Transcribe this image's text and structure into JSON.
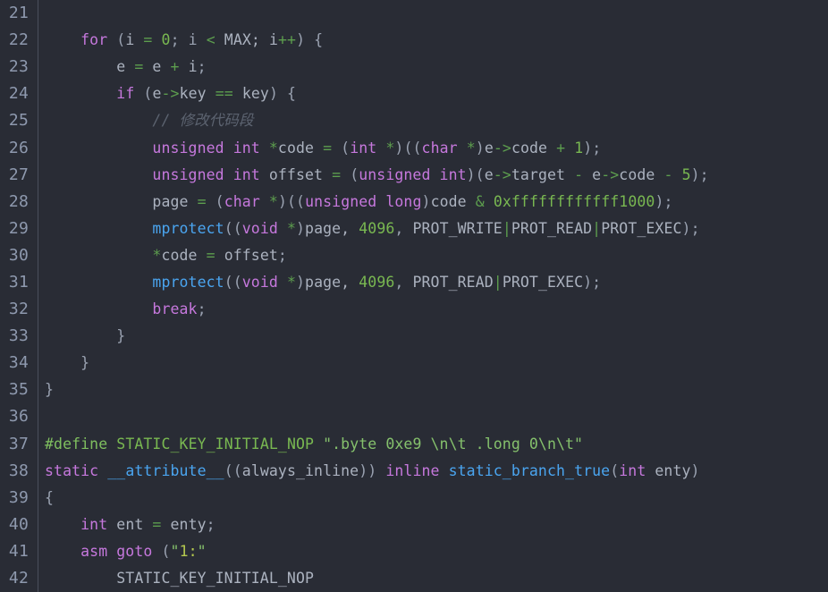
{
  "editor": {
    "name": "code-editor",
    "theme": "one-dark",
    "colors": {
      "background": "#292c35",
      "gutter_text": "#8e99ae",
      "gutter_rule": "#4a4f5c",
      "default_text": "#abb2bf",
      "keyword": "#c678dd",
      "operator": "#5d9e4e",
      "number": "#79b851",
      "function": "#4aa5f0",
      "comment": "#5c6370",
      "preprocessor": "#7fbf5f",
      "string": "#85c16c"
    },
    "language": "c",
    "first_line_number": 21,
    "last_line_number": 42
  },
  "lines": [
    {
      "number": "21",
      "text": ""
    },
    {
      "number": "22",
      "text": "    for (i = 0; i < MAX; i++) {"
    },
    {
      "number": "23",
      "text": "        e = e + i;"
    },
    {
      "number": "24",
      "text": "        if (e->key == key) {"
    },
    {
      "number": "25",
      "text": "            // 修改代码段"
    },
    {
      "number": "26",
      "text": "            unsigned int *code = (int *)((char *)e->code + 1);"
    },
    {
      "number": "27",
      "text": "            unsigned int offset = (unsigned int)(e->target - e->code - 5);"
    },
    {
      "number": "28",
      "text": "            page = (char *)((unsigned long)code & 0xffffffffffff1000);"
    },
    {
      "number": "29",
      "text": "            mprotect((void *)page, 4096, PROT_WRITE|PROT_READ|PROT_EXEC);"
    },
    {
      "number": "30",
      "text": "            *code = offset;"
    },
    {
      "number": "31",
      "text": "            mprotect((void *)page, 4096, PROT_READ|PROT_EXEC);"
    },
    {
      "number": "32",
      "text": "            break;"
    },
    {
      "number": "33",
      "text": "        }"
    },
    {
      "number": "34",
      "text": "    }"
    },
    {
      "number": "35",
      "text": "}"
    },
    {
      "number": "36",
      "text": ""
    },
    {
      "number": "37",
      "text": "#define STATIC_KEY_INITIAL_NOP \".byte 0xe9 \\n\\t .long 0\\n\\t\""
    },
    {
      "number": "38",
      "text": "static __attribute__((always_inline)) inline static_branch_true(int enty)"
    },
    {
      "number": "39",
      "text": "{"
    },
    {
      "number": "40",
      "text": "    int ent = enty;"
    },
    {
      "number": "41",
      "text": "    asm goto (\"1:\""
    },
    {
      "number": "42",
      "text": "        STATIC_KEY_INITIAL_NOP"
    }
  ],
  "tokens": {
    "line21": [],
    "line22": [
      {
        "t": "    ",
        "c": "t-id"
      },
      {
        "t": "for",
        "c": "t-kw"
      },
      {
        "t": " ",
        "c": "t-id"
      },
      {
        "t": "(",
        "c": "t-punc"
      },
      {
        "t": "i ",
        "c": "t-id"
      },
      {
        "t": "=",
        "c": "t-op"
      },
      {
        "t": " ",
        "c": "t-id"
      },
      {
        "t": "0",
        "c": "t-num"
      },
      {
        "t": "; i ",
        "c": "t-punc"
      },
      {
        "t": "<",
        "c": "t-op"
      },
      {
        "t": " MAX; i",
        "c": "t-id"
      },
      {
        "t": "++",
        "c": "t-op"
      },
      {
        "t": ") {",
        "c": "t-punc"
      }
    ],
    "line23": [
      {
        "t": "        e ",
        "c": "t-id"
      },
      {
        "t": "=",
        "c": "t-op"
      },
      {
        "t": " e ",
        "c": "t-id"
      },
      {
        "t": "+",
        "c": "t-op"
      },
      {
        "t": " i",
        "c": "t-id"
      },
      {
        "t": ";",
        "c": "t-punc"
      }
    ],
    "line24": [
      {
        "t": "        ",
        "c": "t-id"
      },
      {
        "t": "if",
        "c": "t-kw"
      },
      {
        "t": " ",
        "c": "t-id"
      },
      {
        "t": "(",
        "c": "t-punc"
      },
      {
        "t": "e",
        "c": "t-id"
      },
      {
        "t": "->",
        "c": "t-op"
      },
      {
        "t": "key ",
        "c": "t-id"
      },
      {
        "t": "==",
        "c": "t-op"
      },
      {
        "t": " key",
        "c": "t-id"
      },
      {
        "t": ") {",
        "c": "t-punc"
      }
    ],
    "line25": [
      {
        "t": "            ",
        "c": "t-id"
      },
      {
        "t": "// 修改代码段",
        "c": "t-comment"
      }
    ],
    "line26": [
      {
        "t": "            ",
        "c": "t-id"
      },
      {
        "t": "unsigned int",
        "c": "t-kw"
      },
      {
        "t": " ",
        "c": "t-id"
      },
      {
        "t": "*",
        "c": "t-op"
      },
      {
        "t": "code ",
        "c": "t-id"
      },
      {
        "t": "=",
        "c": "t-op"
      },
      {
        "t": " ",
        "c": "t-id"
      },
      {
        "t": "(",
        "c": "t-punc"
      },
      {
        "t": "int",
        "c": "t-kw"
      },
      {
        "t": " ",
        "c": "t-id"
      },
      {
        "t": "*",
        "c": "t-op"
      },
      {
        "t": ")((",
        "c": "t-punc"
      },
      {
        "t": "char",
        "c": "t-kw"
      },
      {
        "t": " ",
        "c": "t-id"
      },
      {
        "t": "*",
        "c": "t-op"
      },
      {
        "t": ")",
        "c": "t-punc"
      },
      {
        "t": "e",
        "c": "t-id"
      },
      {
        "t": "->",
        "c": "t-op"
      },
      {
        "t": "code ",
        "c": "t-id"
      },
      {
        "t": "+",
        "c": "t-op"
      },
      {
        "t": " ",
        "c": "t-id"
      },
      {
        "t": "1",
        "c": "t-num"
      },
      {
        "t": ");",
        "c": "t-punc"
      }
    ],
    "line27": [
      {
        "t": "            ",
        "c": "t-id"
      },
      {
        "t": "unsigned int",
        "c": "t-kw"
      },
      {
        "t": " offset ",
        "c": "t-id"
      },
      {
        "t": "=",
        "c": "t-op"
      },
      {
        "t": " ",
        "c": "t-id"
      },
      {
        "t": "(",
        "c": "t-punc"
      },
      {
        "t": "unsigned int",
        "c": "t-kw"
      },
      {
        "t": ")(",
        "c": "t-punc"
      },
      {
        "t": "e",
        "c": "t-id"
      },
      {
        "t": "->",
        "c": "t-op"
      },
      {
        "t": "target ",
        "c": "t-id"
      },
      {
        "t": "-",
        "c": "t-op"
      },
      {
        "t": " e",
        "c": "t-id"
      },
      {
        "t": "->",
        "c": "t-op"
      },
      {
        "t": "code ",
        "c": "t-id"
      },
      {
        "t": "-",
        "c": "t-op"
      },
      {
        "t": " ",
        "c": "t-id"
      },
      {
        "t": "5",
        "c": "t-num"
      },
      {
        "t": ");",
        "c": "t-punc"
      }
    ],
    "line28": [
      {
        "t": "            page ",
        "c": "t-id"
      },
      {
        "t": "=",
        "c": "t-op"
      },
      {
        "t": " ",
        "c": "t-id"
      },
      {
        "t": "(",
        "c": "t-punc"
      },
      {
        "t": "char",
        "c": "t-kw"
      },
      {
        "t": " ",
        "c": "t-id"
      },
      {
        "t": "*",
        "c": "t-op"
      },
      {
        "t": ")((",
        "c": "t-punc"
      },
      {
        "t": "unsigned long",
        "c": "t-kw"
      },
      {
        "t": ")",
        "c": "t-punc"
      },
      {
        "t": "code ",
        "c": "t-id"
      },
      {
        "t": "&",
        "c": "t-op"
      },
      {
        "t": " ",
        "c": "t-id"
      },
      {
        "t": "0xffffffffffff1000",
        "c": "t-num"
      },
      {
        "t": ");",
        "c": "t-punc"
      }
    ],
    "line29": [
      {
        "t": "            ",
        "c": "t-id"
      },
      {
        "t": "mprotect",
        "c": "t-fn"
      },
      {
        "t": "((",
        "c": "t-punc"
      },
      {
        "t": "void",
        "c": "t-kw"
      },
      {
        "t": " ",
        "c": "t-id"
      },
      {
        "t": "*",
        "c": "t-op"
      },
      {
        "t": ")",
        "c": "t-punc"
      },
      {
        "t": "page, ",
        "c": "t-id"
      },
      {
        "t": "4096",
        "c": "t-num"
      },
      {
        "t": ", ",
        "c": "t-punc"
      },
      {
        "t": "PROT_WRITE",
        "c": "t-id"
      },
      {
        "t": "|",
        "c": "t-op"
      },
      {
        "t": "PROT_READ",
        "c": "t-id"
      },
      {
        "t": "|",
        "c": "t-op"
      },
      {
        "t": "PROT_EXEC",
        "c": "t-id"
      },
      {
        "t": ");",
        "c": "t-punc"
      }
    ],
    "line30": [
      {
        "t": "            ",
        "c": "t-id"
      },
      {
        "t": "*",
        "c": "t-op"
      },
      {
        "t": "code ",
        "c": "t-id"
      },
      {
        "t": "=",
        "c": "t-op"
      },
      {
        "t": " offset",
        "c": "t-id"
      },
      {
        "t": ";",
        "c": "t-punc"
      }
    ],
    "line31": [
      {
        "t": "            ",
        "c": "t-id"
      },
      {
        "t": "mprotect",
        "c": "t-fn"
      },
      {
        "t": "((",
        "c": "t-punc"
      },
      {
        "t": "void",
        "c": "t-kw"
      },
      {
        "t": " ",
        "c": "t-id"
      },
      {
        "t": "*",
        "c": "t-op"
      },
      {
        "t": ")",
        "c": "t-punc"
      },
      {
        "t": "page, ",
        "c": "t-id"
      },
      {
        "t": "4096",
        "c": "t-num"
      },
      {
        "t": ", ",
        "c": "t-punc"
      },
      {
        "t": "PROT_READ",
        "c": "t-id"
      },
      {
        "t": "|",
        "c": "t-op"
      },
      {
        "t": "PROT_EXEC",
        "c": "t-id"
      },
      {
        "t": ");",
        "c": "t-punc"
      }
    ],
    "line32": [
      {
        "t": "            ",
        "c": "t-id"
      },
      {
        "t": "break",
        "c": "t-kw"
      },
      {
        "t": ";",
        "c": "t-punc"
      }
    ],
    "line33": [
      {
        "t": "        }",
        "c": "t-punc"
      }
    ],
    "line34": [
      {
        "t": "    }",
        "c": "t-punc"
      }
    ],
    "line35": [
      {
        "t": "}",
        "c": "t-punc"
      }
    ],
    "line36": [],
    "line37": [
      {
        "t": "#define",
        "c": "t-pre"
      },
      {
        "t": " ",
        "c": "t-id"
      },
      {
        "t": "STATIC_KEY_INITIAL_NOP",
        "c": "t-macro"
      },
      {
        "t": " ",
        "c": "t-id"
      },
      {
        "t": "\".byte ",
        "c": "t-str"
      },
      {
        "t": "0xe9",
        "c": "t-str"
      },
      {
        "t": " \\n\\t .long 0\\n\\t\"",
        "c": "t-str"
      }
    ],
    "line38": [
      {
        "t": "static",
        "c": "t-kw"
      },
      {
        "t": " ",
        "c": "t-id"
      },
      {
        "t": "__attribute__",
        "c": "t-fn"
      },
      {
        "t": "((",
        "c": "t-punc"
      },
      {
        "t": "always_inline",
        "c": "t-id"
      },
      {
        "t": ")) ",
        "c": "t-punc"
      },
      {
        "t": "inline",
        "c": "t-kw"
      },
      {
        "t": " ",
        "c": "t-id"
      },
      {
        "t": "static_branch_true",
        "c": "t-fn"
      },
      {
        "t": "(",
        "c": "t-punc"
      },
      {
        "t": "int",
        "c": "t-kw"
      },
      {
        "t": " enty",
        "c": "t-id"
      },
      {
        "t": ")",
        "c": "t-punc"
      }
    ],
    "line39": [
      {
        "t": "{",
        "c": "t-punc"
      }
    ],
    "line40": [
      {
        "t": "    ",
        "c": "t-id"
      },
      {
        "t": "int",
        "c": "t-kw"
      },
      {
        "t": " ent ",
        "c": "t-id"
      },
      {
        "t": "=",
        "c": "t-op"
      },
      {
        "t": " enty",
        "c": "t-id"
      },
      {
        "t": ";",
        "c": "t-punc"
      }
    ],
    "line41": [
      {
        "t": "    ",
        "c": "t-id"
      },
      {
        "t": "asm goto",
        "c": "t-kw"
      },
      {
        "t": " ",
        "c": "t-id"
      },
      {
        "t": "(",
        "c": "t-punc"
      },
      {
        "t": "\"",
        "c": "t-str"
      },
      {
        "t": "1:",
        "c": "t-strnum"
      },
      {
        "t": "\"",
        "c": "t-str"
      }
    ],
    "line42": [
      {
        "t": "        STATIC_KEY_INITIAL_NOP",
        "c": "t-id"
      }
    ]
  }
}
